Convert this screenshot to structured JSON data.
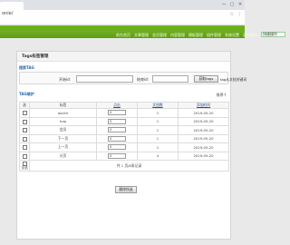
{
  "browser": {
    "url": "onie/",
    "window_controls": [
      "—",
      "▢",
      "✕"
    ]
  },
  "nav": {
    "items": [
      "前台首页",
      "文章管理",
      "会员管理",
      "内容管理",
      "模板管理",
      "插件管理",
      "系统设置",
      "清除缓存"
    ],
    "quick_button": "快捷操作"
  },
  "page": {
    "title": "Tags标签管理",
    "search_section_title": "搜索TAG",
    "start_label": "开始id:",
    "end_label": "结束id:",
    "search_button": "获取tags",
    "search_hint": "tag从文档关键词",
    "list_section_title": "TAG维护",
    "sort_link": "排序↑",
    "columns": [
      "选",
      "标签",
      "点击",
      "文档数",
      "添加时间"
    ],
    "rows": [
      {
        "tag": "ascilit",
        "clicks": "0",
        "docs": "1",
        "date": "2019-05-20"
      },
      {
        "tag": "hap",
        "clicks": "0",
        "docs": "1",
        "date": "2019-05-20"
      },
      {
        "tag": "会员",
        "clicks": "0",
        "docs": "1",
        "date": "2019-05-20"
      },
      {
        "tag": "下一页",
        "clicks": "0",
        "docs": "1",
        "date": "2019-05-20"
      },
      {
        "tag": "上一页",
        "clicks": "0",
        "docs": "1",
        "date": "2019-05-20"
      },
      {
        "tag": "分页",
        "clicks": "0",
        "docs": "4",
        "date": "2019-05-20"
      }
    ],
    "select_all_label": "全选",
    "pager_text": "共 1 页/6条记录",
    "delete_button": "删除所选"
  }
}
